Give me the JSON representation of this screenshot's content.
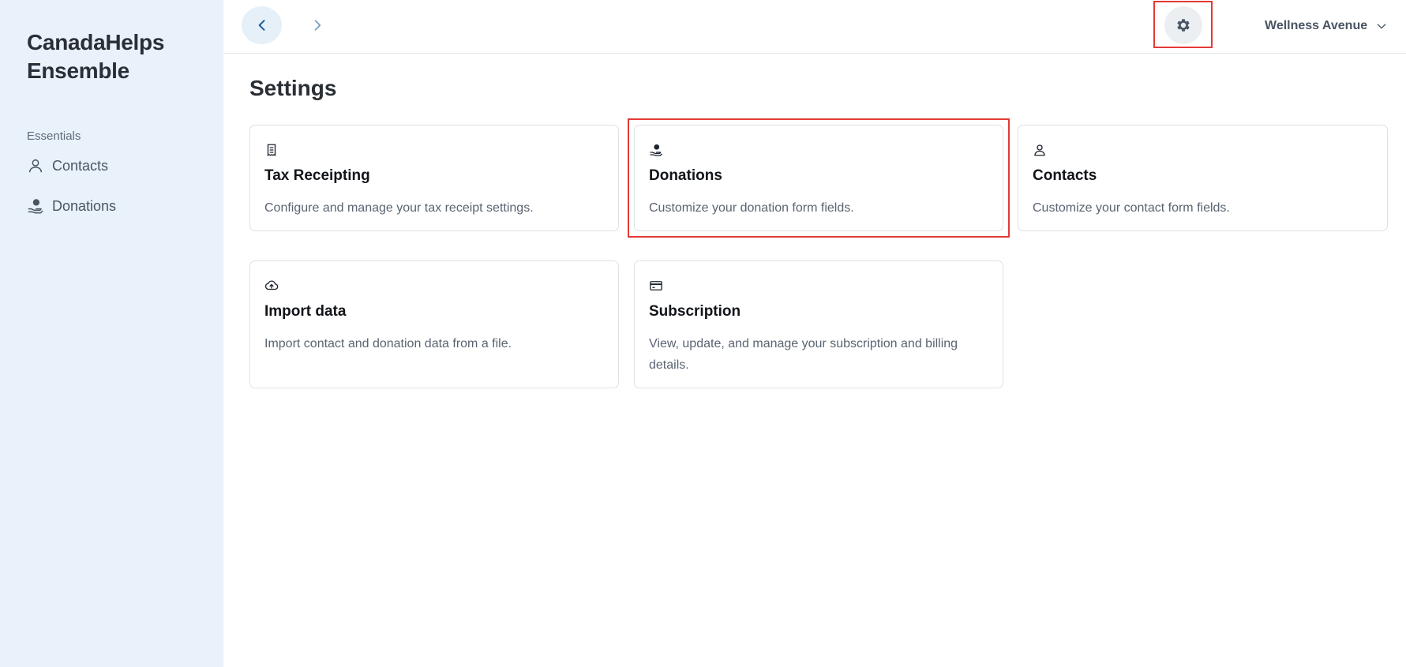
{
  "sidebar": {
    "brand_line1": "CanadaHelps",
    "brand_line2": "Ensemble",
    "section_label": "Essentials",
    "items": [
      {
        "label": "Contacts",
        "icon": "person-icon"
      },
      {
        "label": "Donations",
        "icon": "hand-coin-icon"
      }
    ]
  },
  "topbar": {
    "back_icon": "chevron-left-icon",
    "forward_icon": "chevron-right-icon",
    "settings_icon": "gear-icon",
    "org_name": "Wellness Avenue",
    "org_dropdown_icon": "chevron-down-icon"
  },
  "main": {
    "title": "Settings",
    "cards": [
      {
        "title": "Tax Receipting",
        "description": "Configure and manage your tax receipt settings.",
        "icon": "receipt-icon"
      },
      {
        "title": "Donations",
        "description": "Customize your donation form fields.",
        "icon": "hand-coin-icon"
      },
      {
        "title": "Contacts",
        "description": "Customize your contact form fields.",
        "icon": "person-icon"
      },
      {
        "title": "Import data",
        "description": "Import contact and donation data from a file.",
        "icon": "cloud-upload-icon"
      },
      {
        "title": "Subscription",
        "description": "View, update, and manage your subscription and billing details.",
        "icon": "credit-card-icon"
      }
    ]
  },
  "colors": {
    "sidebar_bg": "#e9f2fa",
    "highlight": "#e53935",
    "accent": "#1f5e9b"
  }
}
